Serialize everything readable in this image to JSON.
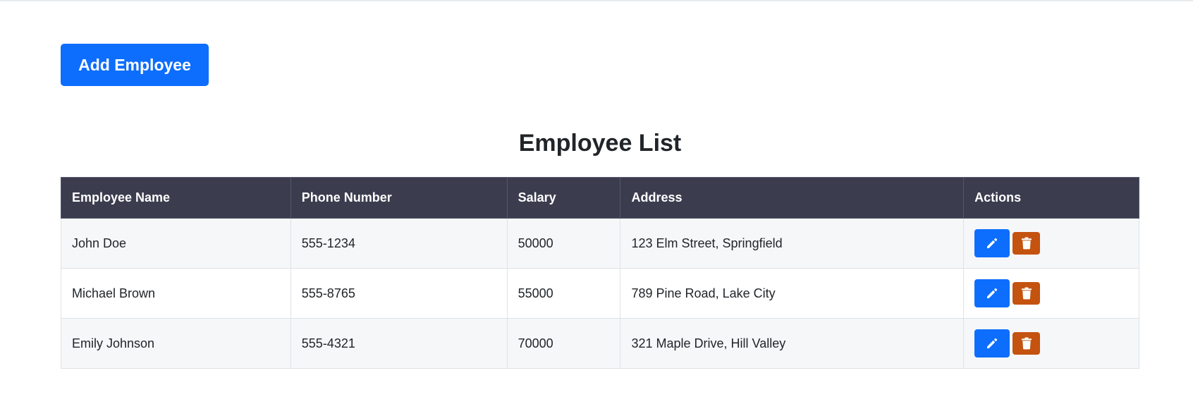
{
  "toolbar": {
    "add_label": "Add Employee"
  },
  "page": {
    "title": "Employee List"
  },
  "table": {
    "headers": [
      "Employee Name",
      "Phone Number",
      "Salary",
      "Address",
      "Actions"
    ],
    "rows": [
      {
        "name": "John Doe",
        "phone": "555-1234",
        "salary": "50000",
        "address": "123 Elm Street, Springfield"
      },
      {
        "name": "Michael Brown",
        "phone": "555-8765",
        "salary": "55000",
        "address": "789 Pine Road, Lake City"
      },
      {
        "name": "Emily Johnson",
        "phone": "555-4321",
        "salary": "70000",
        "address": "321 Maple Drive, Hill Valley"
      }
    ]
  },
  "icons": {
    "edit": "pencil-icon",
    "delete": "trash-icon"
  },
  "colors": {
    "primary": "#0d6efd",
    "danger": "#c4530f",
    "header_bg": "#3b3d4f"
  }
}
